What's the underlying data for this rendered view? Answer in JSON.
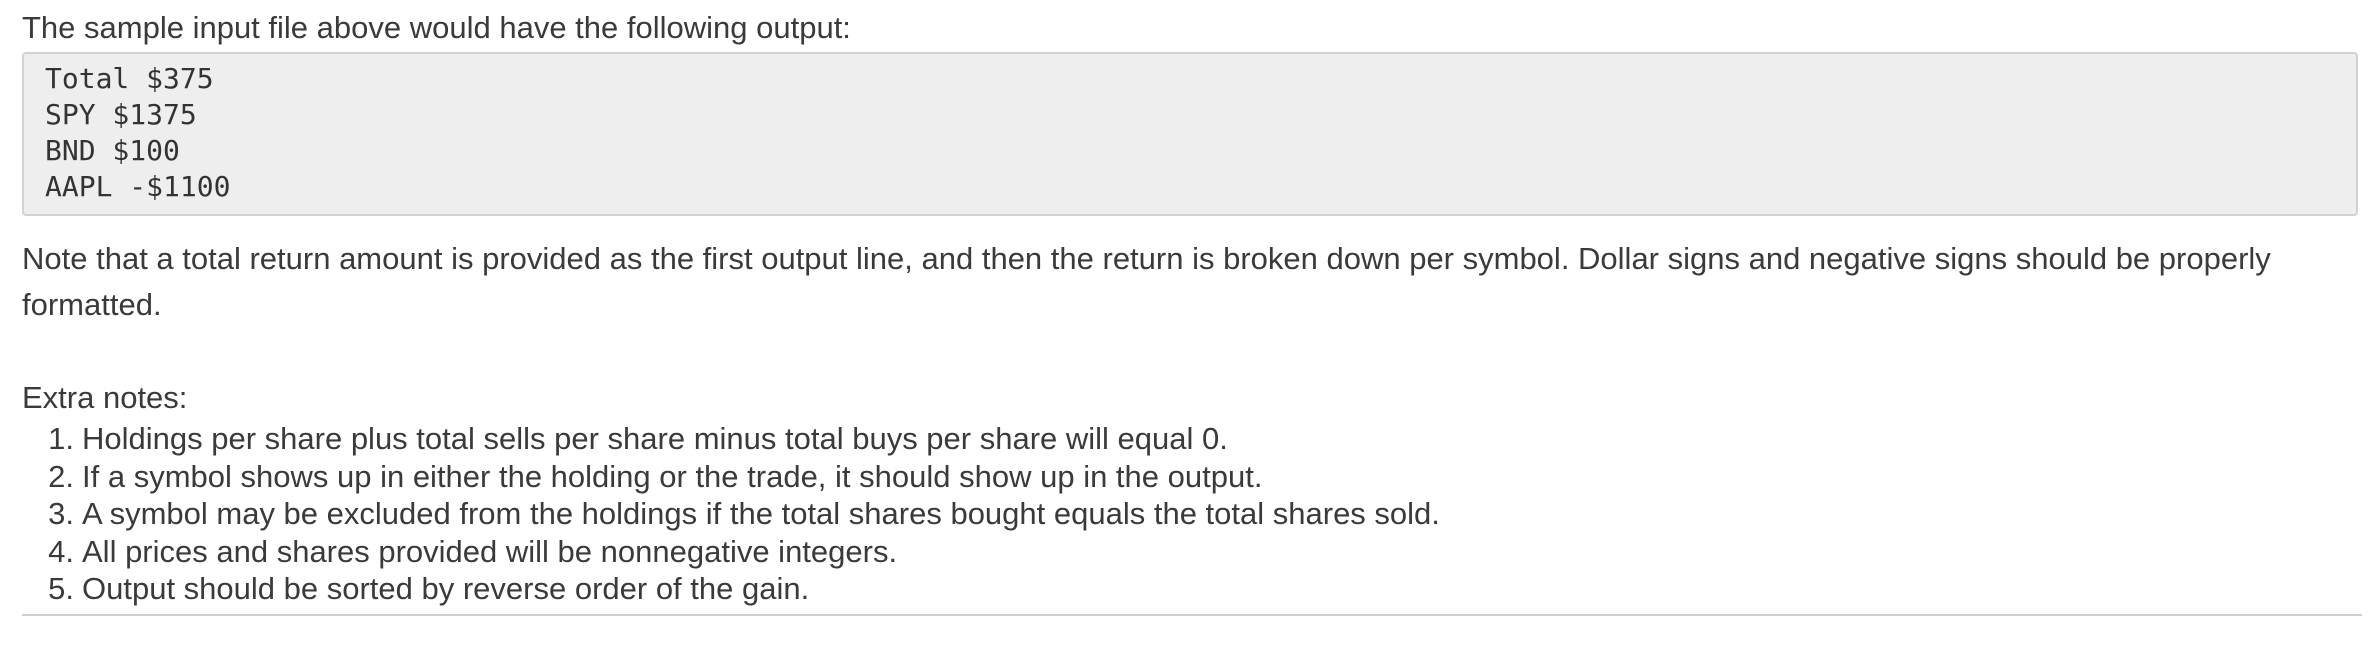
{
  "intro": "The sample input file above would have the following output:",
  "output_lines": [
    "Total $375",
    "SPY $1375",
    "BND $100",
    "AAPL -$1100"
  ],
  "note": "Note that a total return amount is provided as the first output line, and then the return is broken down per symbol. Dollar signs and negative signs should be properly formatted.",
  "extra": {
    "title": "Extra notes:",
    "items": [
      {
        "num": "1.",
        "text": "Holdings per share plus total sells per share minus total buys per share will equal 0."
      },
      {
        "num": "2.",
        "text": "If a symbol shows up in either the holding or the trade, it should show up in the output."
      },
      {
        "num": "3.",
        "text": "A symbol may be excluded from the holdings if the total shares bought equals the total shares sold."
      },
      {
        "num": "4.",
        "text": "All prices and shares provided will be nonnegative integers."
      },
      {
        "num": "5.",
        "text": "Output should be sorted by reverse order of the gain."
      }
    ]
  }
}
